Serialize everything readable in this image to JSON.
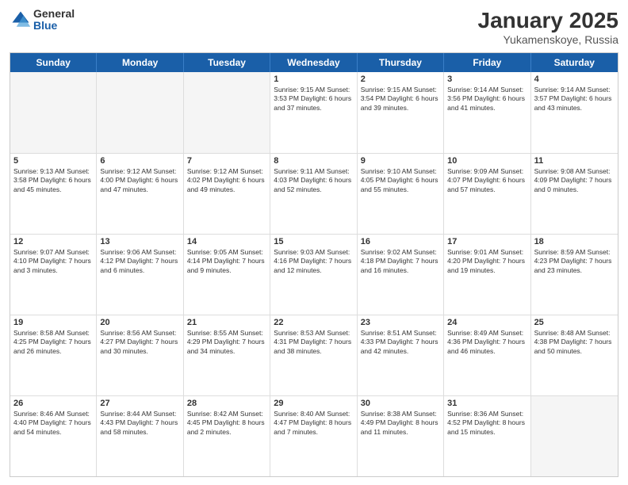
{
  "logo": {
    "general": "General",
    "blue": "Blue"
  },
  "title": "January 2025",
  "location": "Yukamenskoye, Russia",
  "days": [
    "Sunday",
    "Monday",
    "Tuesday",
    "Wednesday",
    "Thursday",
    "Friday",
    "Saturday"
  ],
  "weeks": [
    [
      {
        "day": "",
        "info": ""
      },
      {
        "day": "",
        "info": ""
      },
      {
        "day": "",
        "info": ""
      },
      {
        "day": "1",
        "info": "Sunrise: 9:15 AM\nSunset: 3:53 PM\nDaylight: 6 hours\nand 37 minutes."
      },
      {
        "day": "2",
        "info": "Sunrise: 9:15 AM\nSunset: 3:54 PM\nDaylight: 6 hours\nand 39 minutes."
      },
      {
        "day": "3",
        "info": "Sunrise: 9:14 AM\nSunset: 3:56 PM\nDaylight: 6 hours\nand 41 minutes."
      },
      {
        "day": "4",
        "info": "Sunrise: 9:14 AM\nSunset: 3:57 PM\nDaylight: 6 hours\nand 43 minutes."
      }
    ],
    [
      {
        "day": "5",
        "info": "Sunrise: 9:13 AM\nSunset: 3:58 PM\nDaylight: 6 hours\nand 45 minutes."
      },
      {
        "day": "6",
        "info": "Sunrise: 9:12 AM\nSunset: 4:00 PM\nDaylight: 6 hours\nand 47 minutes."
      },
      {
        "day": "7",
        "info": "Sunrise: 9:12 AM\nSunset: 4:02 PM\nDaylight: 6 hours\nand 49 minutes."
      },
      {
        "day": "8",
        "info": "Sunrise: 9:11 AM\nSunset: 4:03 PM\nDaylight: 6 hours\nand 52 minutes."
      },
      {
        "day": "9",
        "info": "Sunrise: 9:10 AM\nSunset: 4:05 PM\nDaylight: 6 hours\nand 55 minutes."
      },
      {
        "day": "10",
        "info": "Sunrise: 9:09 AM\nSunset: 4:07 PM\nDaylight: 6 hours\nand 57 minutes."
      },
      {
        "day": "11",
        "info": "Sunrise: 9:08 AM\nSunset: 4:09 PM\nDaylight: 7 hours\nand 0 minutes."
      }
    ],
    [
      {
        "day": "12",
        "info": "Sunrise: 9:07 AM\nSunset: 4:10 PM\nDaylight: 7 hours\nand 3 minutes."
      },
      {
        "day": "13",
        "info": "Sunrise: 9:06 AM\nSunset: 4:12 PM\nDaylight: 7 hours\nand 6 minutes."
      },
      {
        "day": "14",
        "info": "Sunrise: 9:05 AM\nSunset: 4:14 PM\nDaylight: 7 hours\nand 9 minutes."
      },
      {
        "day": "15",
        "info": "Sunrise: 9:03 AM\nSunset: 4:16 PM\nDaylight: 7 hours\nand 12 minutes."
      },
      {
        "day": "16",
        "info": "Sunrise: 9:02 AM\nSunset: 4:18 PM\nDaylight: 7 hours\nand 16 minutes."
      },
      {
        "day": "17",
        "info": "Sunrise: 9:01 AM\nSunset: 4:20 PM\nDaylight: 7 hours\nand 19 minutes."
      },
      {
        "day": "18",
        "info": "Sunrise: 8:59 AM\nSunset: 4:23 PM\nDaylight: 7 hours\nand 23 minutes."
      }
    ],
    [
      {
        "day": "19",
        "info": "Sunrise: 8:58 AM\nSunset: 4:25 PM\nDaylight: 7 hours\nand 26 minutes."
      },
      {
        "day": "20",
        "info": "Sunrise: 8:56 AM\nSunset: 4:27 PM\nDaylight: 7 hours\nand 30 minutes."
      },
      {
        "day": "21",
        "info": "Sunrise: 8:55 AM\nSunset: 4:29 PM\nDaylight: 7 hours\nand 34 minutes."
      },
      {
        "day": "22",
        "info": "Sunrise: 8:53 AM\nSunset: 4:31 PM\nDaylight: 7 hours\nand 38 minutes."
      },
      {
        "day": "23",
        "info": "Sunrise: 8:51 AM\nSunset: 4:33 PM\nDaylight: 7 hours\nand 42 minutes."
      },
      {
        "day": "24",
        "info": "Sunrise: 8:49 AM\nSunset: 4:36 PM\nDaylight: 7 hours\nand 46 minutes."
      },
      {
        "day": "25",
        "info": "Sunrise: 8:48 AM\nSunset: 4:38 PM\nDaylight: 7 hours\nand 50 minutes."
      }
    ],
    [
      {
        "day": "26",
        "info": "Sunrise: 8:46 AM\nSunset: 4:40 PM\nDaylight: 7 hours\nand 54 minutes."
      },
      {
        "day": "27",
        "info": "Sunrise: 8:44 AM\nSunset: 4:43 PM\nDaylight: 7 hours\nand 58 minutes."
      },
      {
        "day": "28",
        "info": "Sunrise: 8:42 AM\nSunset: 4:45 PM\nDaylight: 8 hours\nand 2 minutes."
      },
      {
        "day": "29",
        "info": "Sunrise: 8:40 AM\nSunset: 4:47 PM\nDaylight: 8 hours\nand 7 minutes."
      },
      {
        "day": "30",
        "info": "Sunrise: 8:38 AM\nSunset: 4:49 PM\nDaylight: 8 hours\nand 11 minutes."
      },
      {
        "day": "31",
        "info": "Sunrise: 8:36 AM\nSunset: 4:52 PM\nDaylight: 8 hours\nand 15 minutes."
      },
      {
        "day": "",
        "info": ""
      }
    ]
  ]
}
